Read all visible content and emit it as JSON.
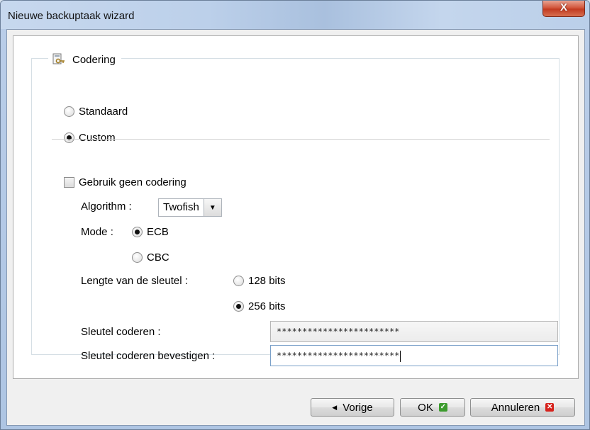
{
  "window": {
    "title": "Nieuwe backuptaak wizard",
    "close_glyph": "X"
  },
  "encoding": {
    "legend": "Codering",
    "legend_icon": "key-file-icon",
    "option_standard": "Standaard",
    "option_custom": "Custom",
    "selected_option": "Custom",
    "no_encryption_label": "Gebruik geen codering",
    "no_encryption_checked": false,
    "algorithm_label": "Algorithm :",
    "algorithm_value": "Twofish",
    "mode_label": "Mode :",
    "mode_ecb": "ECB",
    "mode_cbc": "CBC",
    "mode_selected": "ECB",
    "key_length_label": "Lengte van de sleutel :",
    "key_128": "128 bits",
    "key_256": "256 bits",
    "key_selected": "256 bits",
    "key_label": "Sleutel coderen :",
    "key_value": "************************",
    "confirm_label": "Sleutel coderen bevestigen :",
    "confirm_value": "************************"
  },
  "buttons": {
    "previous": "Vorige",
    "ok": "OK",
    "cancel": "Annuleren"
  },
  "colors": {
    "ok_icon": "#3c9b2d",
    "cancel_icon": "#d6221c",
    "close_button": "#c23b21"
  }
}
